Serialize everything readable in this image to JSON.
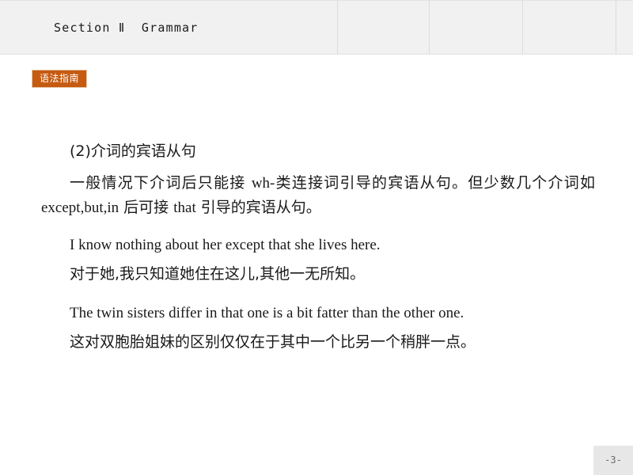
{
  "header": {
    "title": "Section Ⅱ  Grammar",
    "tab_dividers": 4
  },
  "badge": {
    "label": "语法指南",
    "bg_color": "#c55a11",
    "border_color": "#e8c9a8",
    "text_color": "#ffffff"
  },
  "content": {
    "heading": "(2)介词的宾语从句",
    "paragraph_cn_1": "一般情况下介词后只能接 ",
    "paragraph_inline_en_1": "wh-",
    "paragraph_cn_2": "类连接词引导的宾语从句。但少数几个介词如 ",
    "paragraph_inline_en_2": "except,but,in",
    "paragraph_cn_3": " 后可接 ",
    "paragraph_inline_en_3": "that",
    "paragraph_cn_4": " 引导的宾语从句。",
    "example_1_en": "I know nothing about her except that she lives here.",
    "example_1_cn": "对于她,我只知道她住在这儿,其他一无所知。",
    "example_2_en": "The twin sisters differ in that one is a bit fatter than the other one.",
    "example_2_cn": "这对双胞胎姐妹的区别仅仅在于其中一个比另一个稍胖一点。"
  },
  "footer": {
    "page_number": "-3-"
  }
}
